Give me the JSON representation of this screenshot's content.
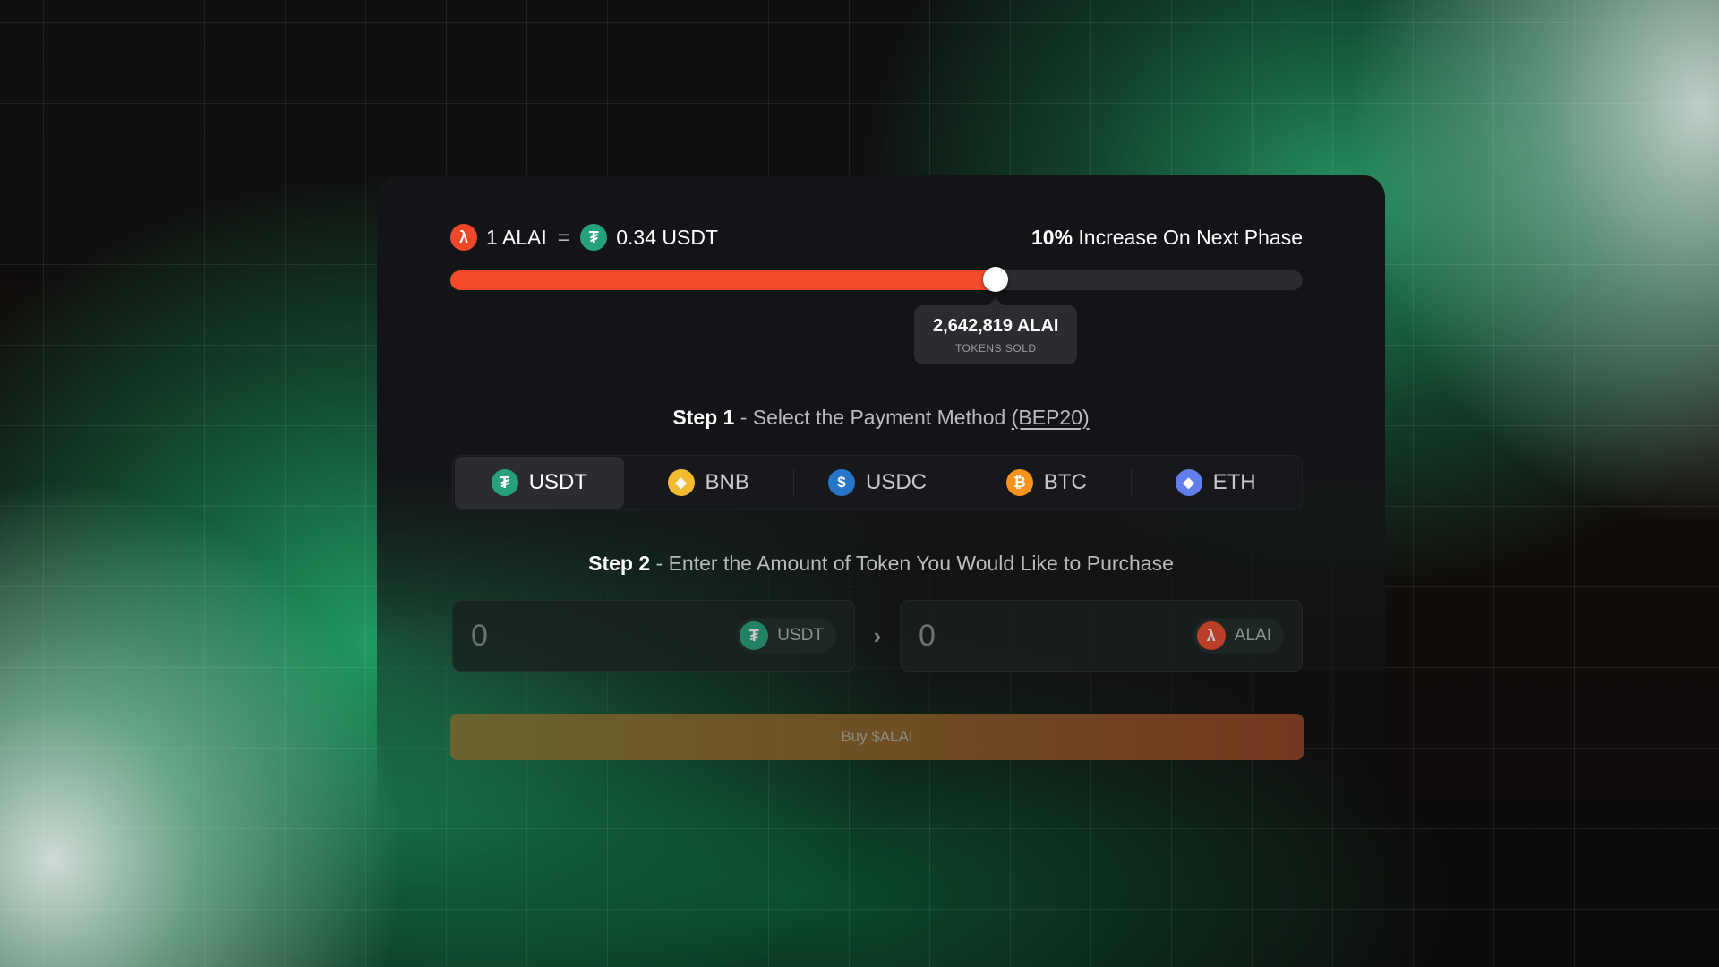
{
  "colors": {
    "accent": "#f24a2a",
    "usdt": "#26a17b",
    "bnb": "#f3ba2f",
    "usdc": "#2775ca",
    "btc": "#f7931a",
    "eth": "#627eea",
    "card": "#131417"
  },
  "rate": {
    "token_icon": "alai-lambda-icon",
    "token_amount": "1 ALAI",
    "equals": "=",
    "quote_icon": "tether-icon",
    "quote_amount": "0.34 USDT"
  },
  "phase": {
    "increase_strong": "10%",
    "increase_text": "Increase On Next Phase"
  },
  "progress": {
    "fraction": 0.64,
    "tokens_sold": "2,642,819 ALAI",
    "tokens_sold_label": "TOKENS SOLD"
  },
  "step1": {
    "label": "Step 1",
    "text": "- Select the Payment Method",
    "network": "(BEP20)"
  },
  "payment_methods": [
    {
      "label": "USDT",
      "icon": "tether-icon",
      "selected": true
    },
    {
      "label": "BNB",
      "icon": "bnb-icon",
      "selected": false
    },
    {
      "label": "USDC",
      "icon": "usdc-icon",
      "selected": false
    },
    {
      "label": "BTC",
      "icon": "bitcoin-icon",
      "selected": false
    },
    {
      "label": "ETH",
      "icon": "ethereum-icon",
      "selected": false
    }
  ],
  "step2": {
    "label": "Step 2",
    "text": "- Enter the Amount of Token You Would Like to Purchase"
  },
  "pay_field": {
    "value": "0",
    "currency": "USDT"
  },
  "receive_field": {
    "value": "0",
    "currency": "ALAI"
  },
  "buy_button": {
    "label": "Buy $ALAI"
  }
}
